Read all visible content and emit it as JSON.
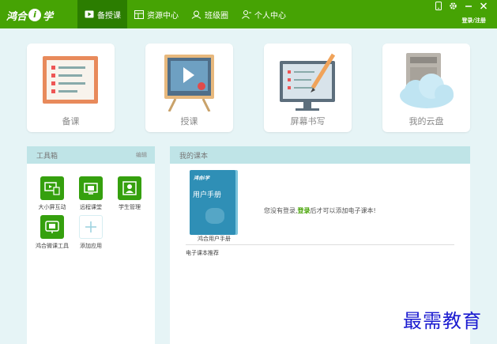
{
  "app": {
    "logo_text": "鸿合",
    "logo_i": "i",
    "logo_suffix": "学"
  },
  "nav": {
    "items": [
      {
        "label": "备授课",
        "active": true,
        "icon": "play-box-icon"
      },
      {
        "label": "资源中心",
        "active": false,
        "icon": "grid-icon"
      },
      {
        "label": "班级圈",
        "active": false,
        "icon": "group-icon"
      },
      {
        "label": "个人中心",
        "active": false,
        "icon": "person-icon"
      }
    ],
    "login_label": "登录/注册"
  },
  "tiles": [
    {
      "label": "备课",
      "icon": "lesson-board-icon"
    },
    {
      "label": "授课",
      "icon": "teaching-easel-icon"
    },
    {
      "label": "屏幕书写",
      "icon": "screen-write-icon"
    },
    {
      "label": "我的云盘",
      "icon": "cloud-disk-icon"
    }
  ],
  "toolbox": {
    "title": "工具箱",
    "edit_label": "编辑",
    "tools": [
      {
        "label": "大小屏互动",
        "icon": "screen-interact-icon"
      },
      {
        "label": "远程课堂",
        "icon": "remote-class-icon"
      },
      {
        "label": "学生管理",
        "icon": "student-manage-icon"
      },
      {
        "label": "鸿合微课工具",
        "icon": "micro-course-icon"
      },
      {
        "label": "添加应用",
        "icon": "plus-icon"
      }
    ]
  },
  "textbooks": {
    "title": "我的课本",
    "book": {
      "cover_logo": "鸿合i学",
      "cover_title": "用户手册",
      "caption": "鸿合用户手册"
    },
    "notice_pre": "您没有登录,",
    "notice_link": "登录",
    "notice_post": "后才可以添加电子课本!",
    "recommend_label": "电子课本推荐"
  },
  "watermark": "最需教育",
  "colors": {
    "brand_green": "#46a304",
    "active_tab": "#2b7d00",
    "panel_head": "#bfe4e7",
    "background": "#e6f4f6"
  }
}
